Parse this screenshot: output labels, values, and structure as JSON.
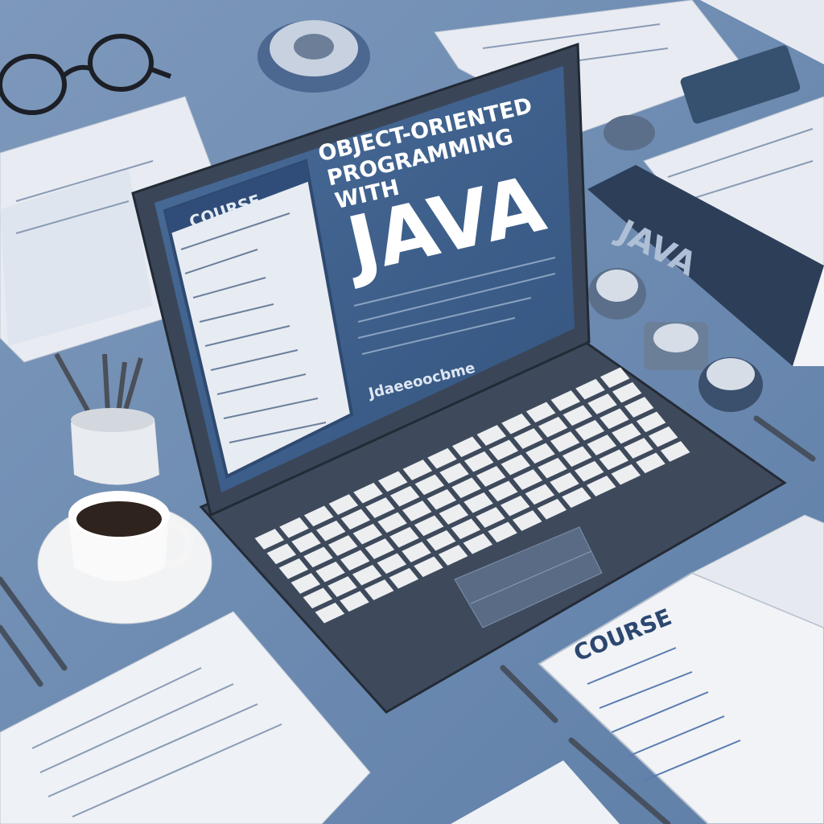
{
  "screen": {
    "title_line1": "OBJECT-ORIENTED",
    "title_line2": "PROGRAMMING",
    "title_line3": "WITH",
    "title_big": "JAVA",
    "side_panel_label": "COURSE",
    "footer_text": "Jdaeeoocbme"
  },
  "book_spine": {
    "label": "JAVA"
  },
  "open_book": {
    "label": "COURSE"
  },
  "colors": {
    "desk": "#6f8db3",
    "laptop_body": "#3e4a5c",
    "screen": "#3d5f8c",
    "paper": "#eef1f5",
    "keys": "#eceef0"
  }
}
